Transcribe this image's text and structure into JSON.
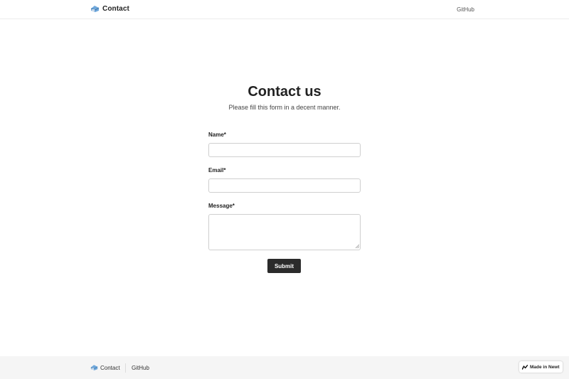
{
  "header": {
    "brand_label": "Contact",
    "github_label": "GitHub"
  },
  "main": {
    "title": "Contact us",
    "subtitle": "Please fill this form in a decent manner."
  },
  "form": {
    "name_label": "Name*",
    "name_value": "",
    "email_label": "Email*",
    "email_value": "",
    "message_label": "Message*",
    "message_value": "",
    "submit_label": "Submit"
  },
  "footer": {
    "brand_label": "Contact",
    "github_label": "GitHub",
    "badge_label": "Made in Newt"
  },
  "colors": {
    "accent": "#2b2b2b",
    "footer_bg": "#f5f5f5",
    "input_border": "#cfcfcf"
  },
  "icons": {
    "brand": "mailbox-icon",
    "badge": "newt-logo-icon",
    "resize": "resize-grip-icon"
  }
}
